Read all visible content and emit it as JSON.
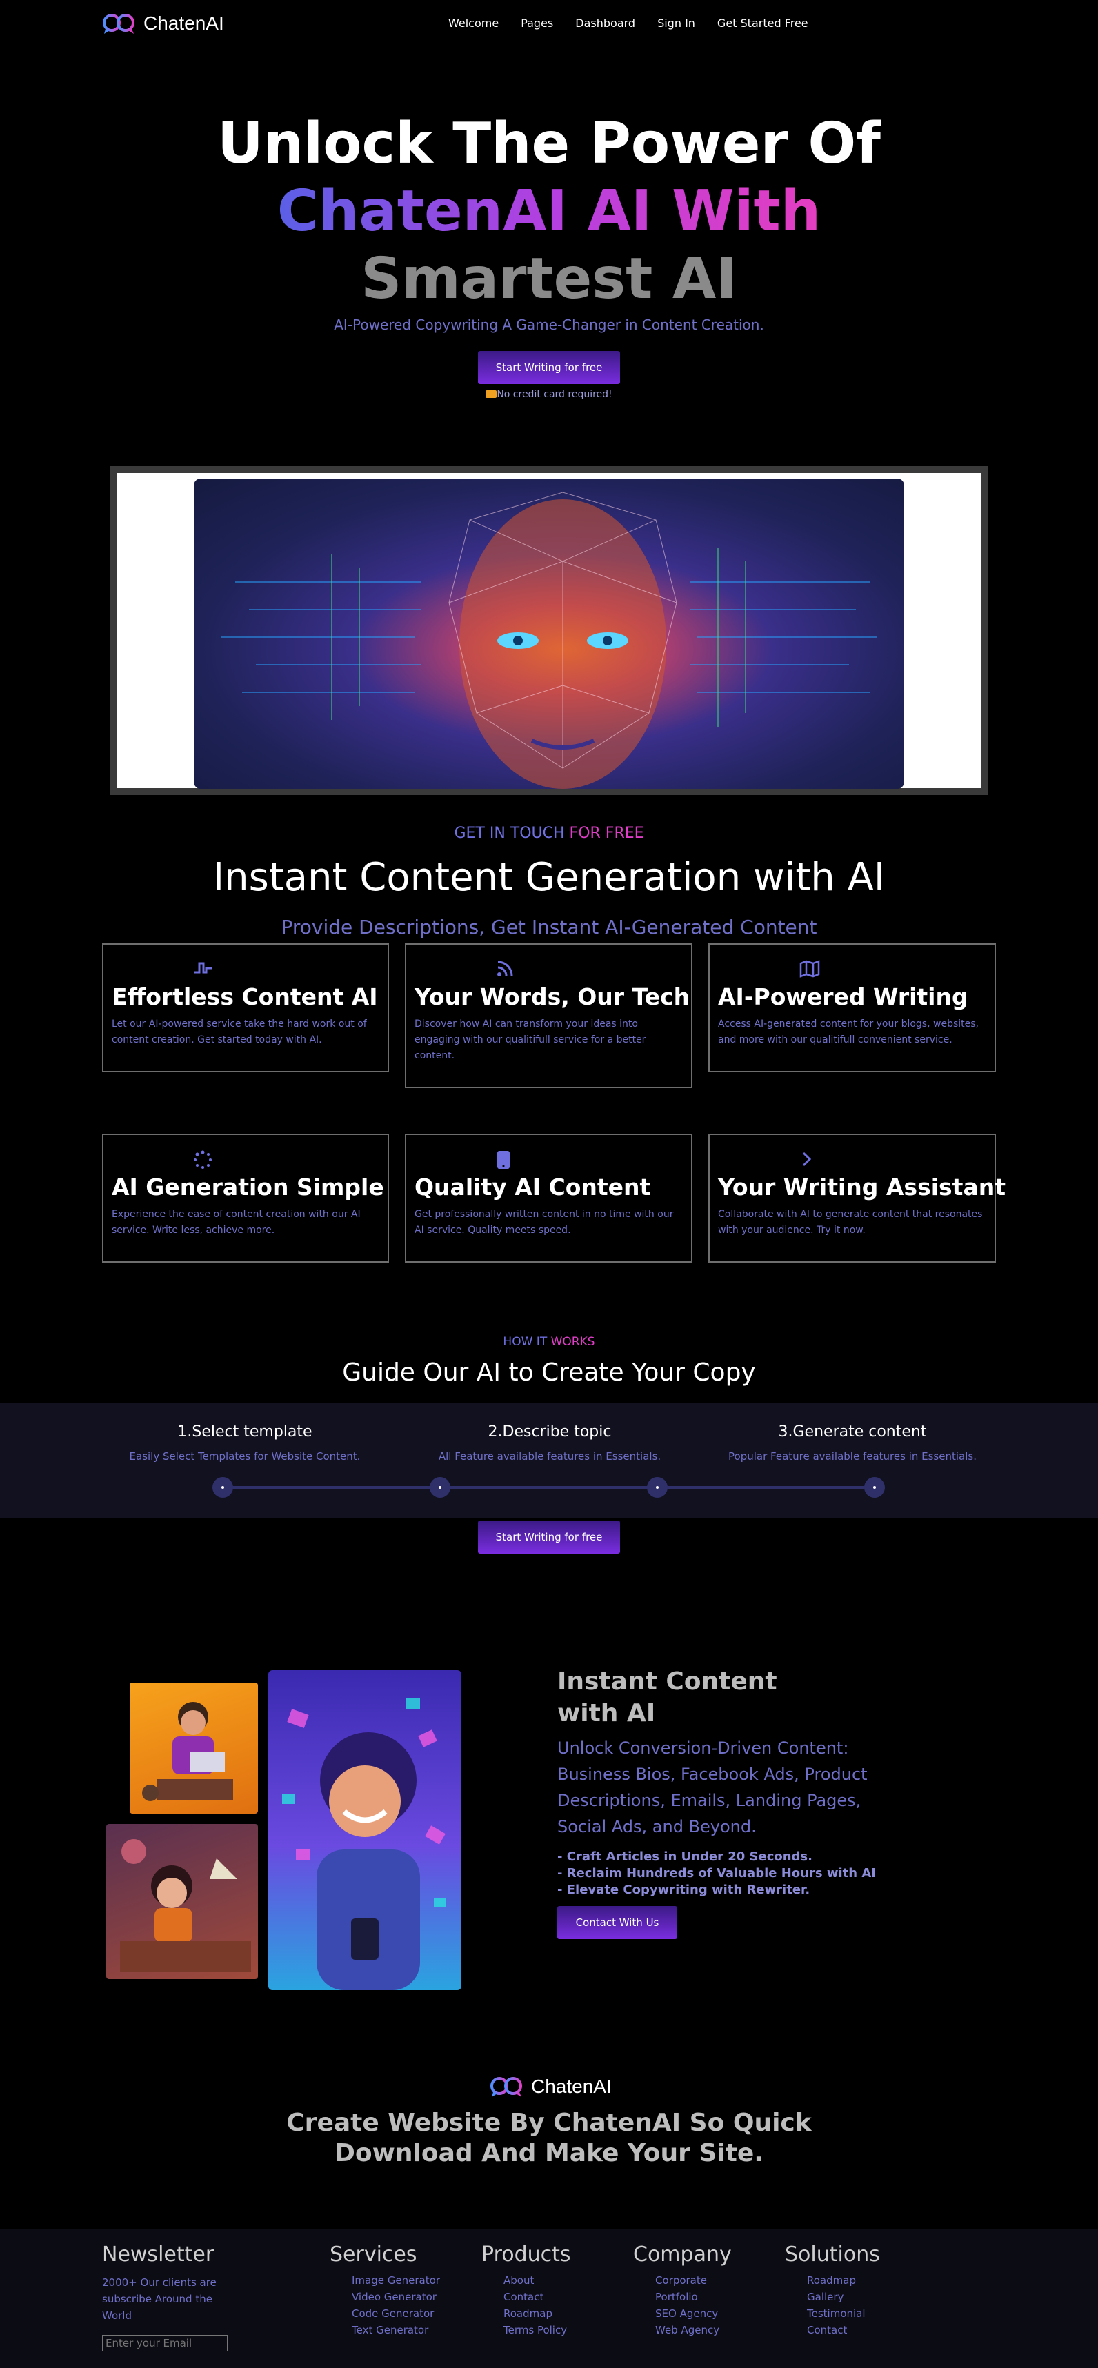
{
  "brand": {
    "name": "ChatenAI"
  },
  "nav": {
    "items": [
      "Welcome",
      "Pages",
      "Dashboard",
      "Sign In",
      "Get Started Free"
    ]
  },
  "hero": {
    "line1": "Unlock The Power Of",
    "line2": "ChatenAI AI With",
    "line3": "Smartest AI",
    "subtitle": "AI-Powered Copywriting A Game-Changer in Content Creation.",
    "cta": "Start Writing for free",
    "note": "No credit card required!"
  },
  "contact_section": {
    "kicker_a": "GET IN TOUCH",
    "kicker_b": "FOR FREE",
    "title": "Instant Content Generation with AI",
    "subtitle": "Provide Descriptions, Get Instant AI-Generated Content"
  },
  "cards": [
    {
      "icon": "pulse-icon",
      "title": "Effortless Content AI",
      "desc": "Let our AI-powered service take the hard work out of content creation. Get started today with AI."
    },
    {
      "icon": "rss-icon",
      "title": "Your Words, Our Tech",
      "desc": "Discover how AI can transform your ideas into engaging with our qualitifull service for a better content."
    },
    {
      "icon": "map-icon",
      "title": "AI-Powered Writing",
      "desc": "Access AI-generated content for your blogs, websites, and more with our qualitifull convenient service."
    },
    {
      "icon": "loader-icon",
      "title": "AI Generation Simple",
      "desc": "Experience the ease of content creation with our AI service. Write less, achieve more."
    },
    {
      "icon": "tablet-icon",
      "title": "Quality AI Content",
      "desc": "Get professionally written content in no time with our AI service. Quality meets speed."
    },
    {
      "icon": "chevron-right-icon",
      "title": "Your Writing Assistant",
      "desc": "Collaborate with AI to generate content that resonates with your audience. Try it now."
    }
  ],
  "how": {
    "kicker_a": "HOW IT",
    "kicker_b": "WORKS",
    "title": "Guide Our AI to Create Your Copy",
    "steps": [
      {
        "title": "1.Select template",
        "desc": "Easily Select Templates for Website Content."
      },
      {
        "title": "2.Describe topic",
        "desc": "All Feature available features in Essentials."
      },
      {
        "title": "3.Generate content",
        "desc": "Popular Feature available features in Essentials."
      }
    ],
    "cta": "Start Writing for free"
  },
  "feature": {
    "title": "Instant Content with AI",
    "subtitle": "Unlock Conversion-Driven Content: Business Bios, Facebook Ads, Product Descriptions, Emails, Landing Pages, Social Ads, and Beyond.",
    "bullets": [
      "- Craft Articles in Under 20 Seconds.",
      "- Reclaim Hundreds of Valuable Hours with AI",
      "- Elevate Copywriting with Rewriter."
    ],
    "cta": "Contact With Us"
  },
  "bottom": {
    "line1": "Create Website By ChatenAI So Quick",
    "line2": "Download And Make Your Site."
  },
  "footer": {
    "newsletter": {
      "title": "Newsletter",
      "text": "2000+ Our clients are subscribe Around the World",
      "placeholder": "Enter your Email"
    },
    "columns": [
      {
        "title": "Services",
        "links": [
          "Image Generator",
          "Video Generator",
          "Code Generator",
          "Text Generator"
        ]
      },
      {
        "title": "Products",
        "links": [
          "About",
          "Contact",
          "Roadmap",
          "Terms Policy"
        ]
      },
      {
        "title": "Company",
        "links": [
          "Corporate",
          "Portfolio",
          "SEO Agency",
          "Web Agency"
        ]
      },
      {
        "title": "Solutions",
        "links": [
          "Roadmap",
          "Gallery",
          "Testimonial",
          "Contact"
        ]
      }
    ]
  },
  "colors": {
    "accent": "#7a2de0",
    "blue": "#6f6fc8",
    "pink": "#e03ec8"
  }
}
